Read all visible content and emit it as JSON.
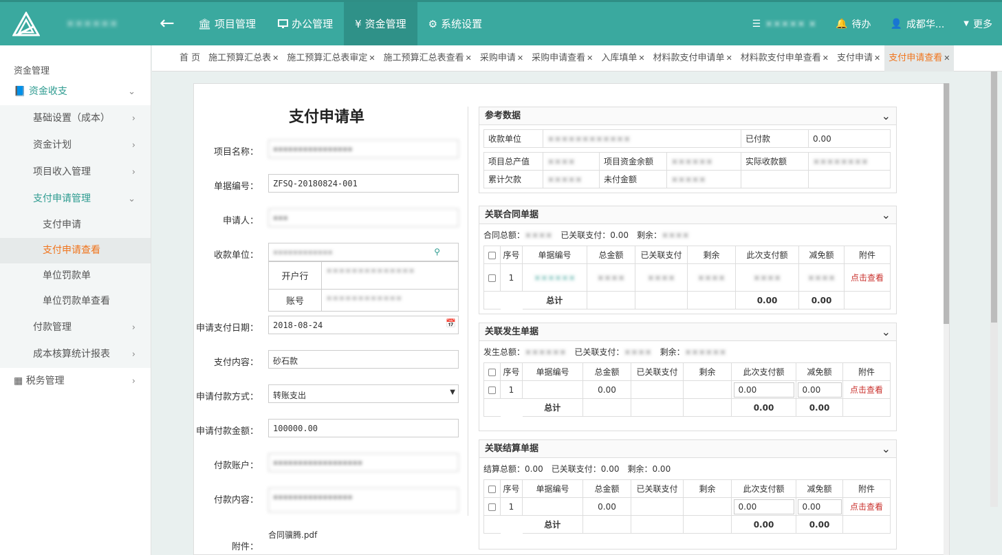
{
  "app": {
    "system_name": "××××××",
    "nav": [
      {
        "icon": "bank-icon",
        "label": "项目管理"
      },
      {
        "icon": "monitor-icon",
        "label": "办公管理"
      },
      {
        "icon": "yen-icon",
        "label": "资金管理"
      },
      {
        "icon": "gear-icon",
        "label": "系统设置"
      }
    ],
    "right": {
      "menu_text": "××××× ×",
      "todo": "待办",
      "user": "成都华...",
      "more": "更多"
    }
  },
  "sidebar": {
    "title": "资金管理",
    "group": "资金收支",
    "items": [
      {
        "label": "基础设置（成本）"
      },
      {
        "label": "资金计划"
      },
      {
        "label": "项目收入管理"
      },
      {
        "label": "支付申请管理"
      },
      {
        "label": "支付申请"
      },
      {
        "label": "支付申请查看"
      },
      {
        "label": "单位罚款单"
      },
      {
        "label": "单位罚款单查看"
      },
      {
        "label": "付款管理"
      },
      {
        "label": "成本核算统计报表"
      }
    ],
    "tax": "税务管理"
  },
  "tabs": [
    {
      "label": "首 页",
      "closable": false
    },
    {
      "label": "施工预算汇总表",
      "closable": true
    },
    {
      "label": "施工预算汇总表审定",
      "closable": true
    },
    {
      "label": "施工预算汇总表查看",
      "closable": true
    },
    {
      "label": "采购申请",
      "closable": true
    },
    {
      "label": "采购申请查看",
      "closable": true
    },
    {
      "label": "入库填单",
      "closable": true
    },
    {
      "label": "材料款支付申请单",
      "closable": true
    },
    {
      "label": "材料款支付申单查看",
      "closable": true
    },
    {
      "label": "支付申请",
      "closable": true
    },
    {
      "label": "支付申请查看",
      "closable": true,
      "active": true
    }
  ],
  "form": {
    "title": "支付申请单",
    "labels": {
      "project": "项目名称：",
      "number": "单据编号：",
      "applicant": "申请人：",
      "payee": "收款单位：",
      "bank": "开户行",
      "account": "账号",
      "date": "申请支付日期：",
      "content": "支付内容：",
      "method": "申请付款方式：",
      "amount": "申请付款金额：",
      "pay_account": "付款账户：",
      "pay_content": "付款内容：",
      "attachment": "附件："
    },
    "values": {
      "project": "××××××××××××××××",
      "number": "ZFSQ-20180824-001",
      "applicant": "×××",
      "payee": "××××××××××××",
      "bank": "××××××××××××××",
      "account": "××××××××××××",
      "date": "2018-08-24",
      "content": "砂石款",
      "method": "转账支出",
      "amount": "100000.00",
      "pay_account": "××××××××××××××××××",
      "pay_content": "××××××××××××××××",
      "attachment_file": "合同骥腾.pdf"
    }
  },
  "reference": {
    "title": "参考数据",
    "payee_label": "收款单位",
    "payee_value": "××××××××××××",
    "paid_label": "已付款",
    "paid_value": "0.00",
    "total_output_label": "项目总产值",
    "total_output_value": "××××",
    "balance_label": "项目资金余额",
    "balance_value": "××××××",
    "received_label": "实际收款额",
    "received_value": "××××××××",
    "debt_label": "累计欠款",
    "debt_value": "×××××",
    "unpaid_label": "未付金额",
    "unpaid_value": "×××××"
  },
  "contract": {
    "title": "关联合同单据",
    "summary": {
      "total_label": "合同总额：",
      "total": "××××",
      "linked_label": "已关联支付：",
      "linked": "0.00",
      "rest_label": "剩余：",
      "rest": "××××"
    },
    "headers": [
      "序号",
      "单据编号",
      "总金额",
      "已关联支付",
      "剩余",
      "此次支付额",
      "减免额",
      "附件"
    ],
    "row": {
      "seq": "1",
      "doc": "××××××",
      "total": "××××",
      "linked": "××××",
      "rest": "××××",
      "pay": "××××",
      "reduce": "××××",
      "attach": "点击查看"
    },
    "sum": {
      "label": "总计",
      "pay": "0.00",
      "reduce": "0.00"
    }
  },
  "occurrence": {
    "title": "关联发生单据",
    "summary": {
      "total_label": "发生总额：",
      "total": "××××××",
      "linked_label": "已关联支付：",
      "linked": "××××",
      "rest_label": "剩余：",
      "rest": "××××××"
    },
    "headers": [
      "序号",
      "单据编号",
      "总金额",
      "已关联支付",
      "剩余",
      "此次支付额",
      "减免额",
      "附件"
    ],
    "row": {
      "seq": "1",
      "total": "0.00",
      "pay": "0.00",
      "reduce": "0.00",
      "attach": "点击查看"
    },
    "sum": {
      "label": "总计",
      "pay": "0.00",
      "reduce": "0.00"
    }
  },
  "settlement": {
    "title": "关联结算单据",
    "summary": {
      "total_label": "结算总额：",
      "total": "0.00",
      "linked_label": "已关联支付：",
      "linked": "0.00",
      "rest_label": "剩余：",
      "rest": "0.00"
    },
    "headers": [
      "序号",
      "单据编号",
      "总金额",
      "已关联支付",
      "剩余",
      "此次支付额",
      "减免额",
      "附件"
    ],
    "row": {
      "seq": "1",
      "total": "0.00",
      "pay": "0.00",
      "reduce": "0.00",
      "attach": "点击查看"
    },
    "sum": {
      "label": "总计",
      "pay": "0.00",
      "reduce": "0.00"
    }
  }
}
